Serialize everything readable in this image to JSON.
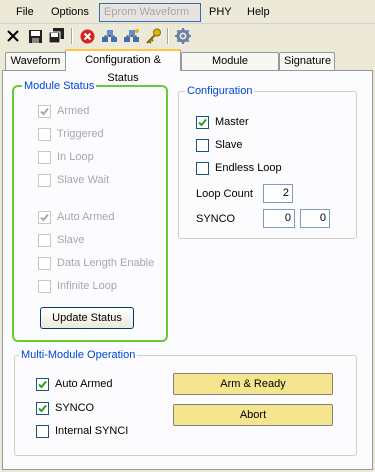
{
  "menu": {
    "file": "File",
    "options": "Options",
    "eprom_waveform": "Eprom Waveform",
    "phy": "PHY",
    "help": "Help"
  },
  "toolbar": {
    "icons": [
      "close-icon",
      "save-icon",
      "save-all-icon",
      "stop-icon",
      "network-icon",
      "network-alt-icon",
      "key-icon",
      "settings-icon"
    ]
  },
  "tabs": {
    "waveform": "Waveform",
    "config_status": "Configuration & Status",
    "module_parameter": "Module Parameter",
    "signature": "Signature"
  },
  "module_status": {
    "title": "Module Status",
    "armed": "Armed",
    "triggered": "Triggered",
    "in_loop": "In Loop",
    "slave_wait": "Slave Wait",
    "auto_armed": "Auto Armed",
    "slave": "Slave",
    "data_length_enable": "Data Length Enable",
    "infinite_loop": "Infinite Loop",
    "update_button": "Update Status"
  },
  "configuration": {
    "title": "Configuration",
    "master": "Master",
    "slave": "Slave",
    "endless_loop": "Endless Loop",
    "loop_count_label": "Loop Count",
    "loop_count_value": "2",
    "synco_label": "SYNCO",
    "synco_value_1": "0",
    "synco_value_2": "0"
  },
  "multi_module": {
    "title": "Multi-Module Operation",
    "auto_armed": "Auto Armed",
    "synco": "SYNCO",
    "internal_synci": "Internal SYNCI",
    "arm_ready_button": "Arm & Ready",
    "abort_button": "Abort"
  }
}
